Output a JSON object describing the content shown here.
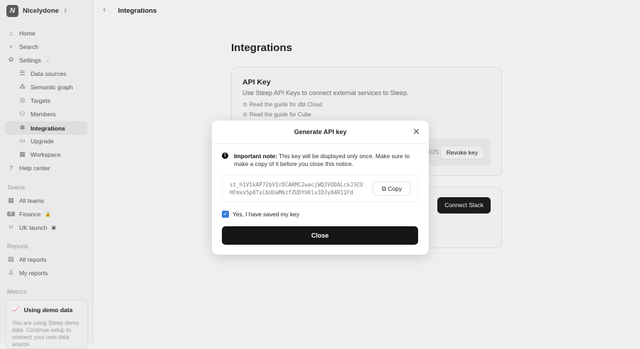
{
  "workspace": {
    "name": "Nicelydone",
    "logo": "N"
  },
  "nav": [
    {
      "label": "Home",
      "icon": "home-icon",
      "glyph": "⌂"
    },
    {
      "label": "Search",
      "icon": "search-icon",
      "glyph": "⌕"
    },
    {
      "label": "Settings",
      "icon": "settings-icon",
      "glyph": "⚙"
    },
    {
      "label": "Data sources",
      "icon": "database-icon",
      "glyph": "☰"
    },
    {
      "label": "Semantic graph",
      "icon": "graph-icon",
      "glyph": "⁂"
    },
    {
      "label": "Targets",
      "icon": "target-icon",
      "glyph": "◎"
    },
    {
      "label": "Members",
      "icon": "members-icon",
      "glyph": "👥"
    },
    {
      "label": "Integrations",
      "icon": "integrations-icon",
      "glyph": "✲"
    },
    {
      "label": "Upgrade",
      "icon": "card-icon",
      "glyph": "▭"
    },
    {
      "label": "Workspace",
      "icon": "building-icon",
      "glyph": "▦"
    },
    {
      "label": "Help center",
      "icon": "help-icon",
      "glyph": "?"
    }
  ],
  "sections": {
    "teams": "Teams",
    "reports": "Reports",
    "metrics": "Metrics"
  },
  "teams": [
    {
      "label": "All teams",
      "badge": "▦"
    },
    {
      "label": "Finance",
      "badge": "F"
    },
    {
      "label": "UK launch",
      "badge": "U"
    }
  ],
  "reports": [
    {
      "label": "All reports"
    },
    {
      "label": "My reports"
    }
  ],
  "demo": {
    "title": "Using demo data",
    "text": "You are using Steep demo data. Continue setup to connect your own data source."
  },
  "header": {
    "breadcrumb": "Integrations"
  },
  "page": {
    "title": "Integrations"
  },
  "api_card": {
    "title": "API Key",
    "desc": "Use Steep API Keys to connect external services to Steep.",
    "guides": [
      "Read the guide for dbt Cloud",
      "Read the guide for Cube"
    ],
    "date_partial": "2025",
    "revoke": "Revoke key"
  },
  "slack_card": {
    "button": "Connect Slack"
  },
  "modal": {
    "title": "Generate API key",
    "note_bold": "Important note:",
    "note": " This key will be displayed only once. Make sure to make a copy of it before you close this notice.",
    "key": "st_h1V1kAP72bV1rDCARMC2wacjWQJVODALckJ3CUHFmxx5p0TxCbUUaM6zfZUDYhKlxIDJy84R11Fd",
    "copy": "Copy",
    "checkbox": "Yes, I have saved my key",
    "checked": true,
    "close": "Close"
  }
}
